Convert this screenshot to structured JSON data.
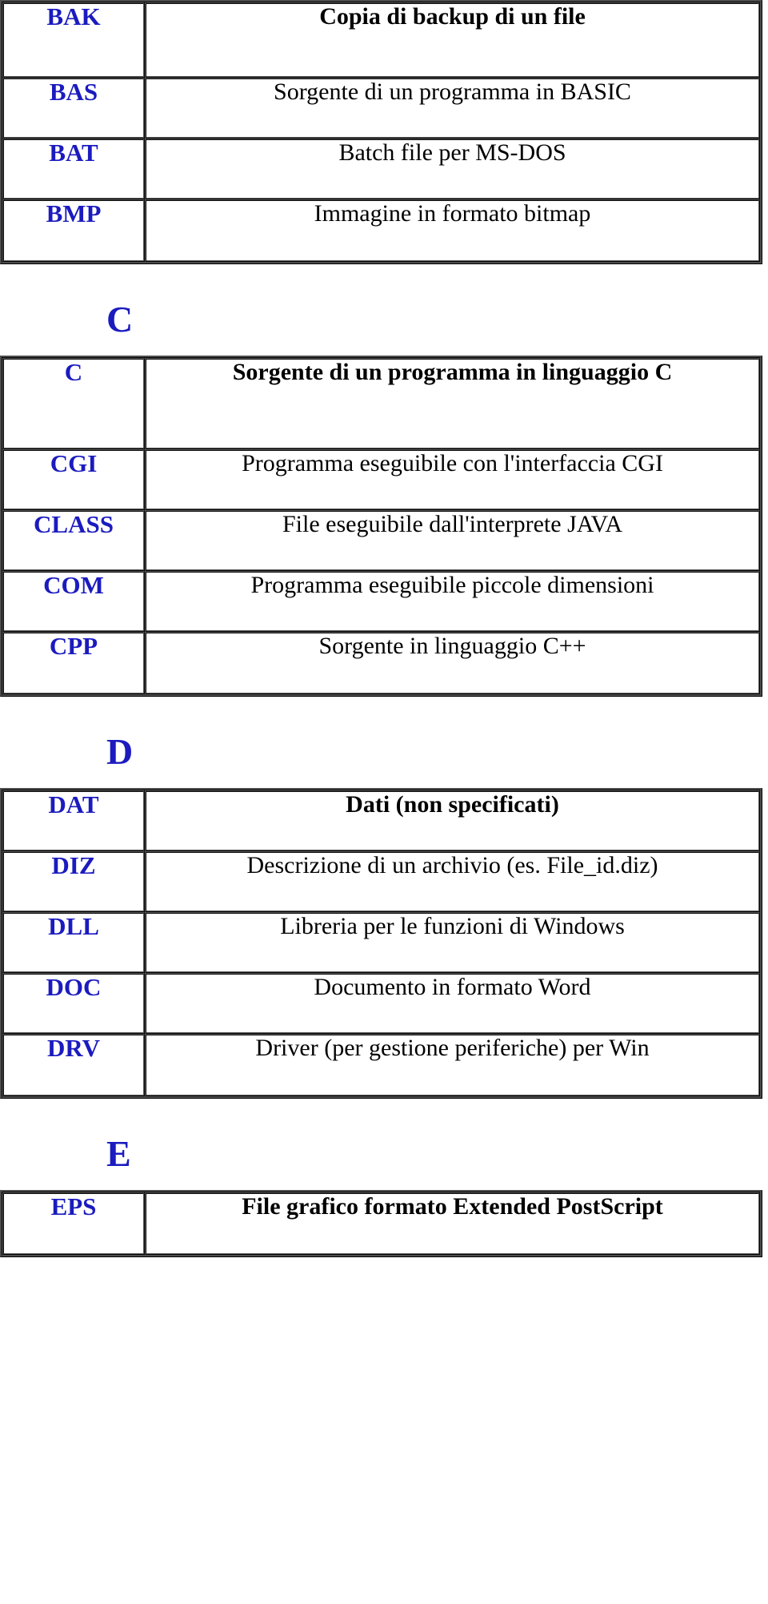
{
  "document": {
    "language": "it",
    "title_implied": "Estensioni dei file",
    "accent_color": "#1b1bbf",
    "text_color": "#000000",
    "background_color": "#ffffff"
  },
  "sections": [
    {
      "letter": "",
      "show_letter": false,
      "rows": [
        {
          "ext": "BAK",
          "desc": "Copia di backup di un file",
          "bold": true
        },
        {
          "ext": "BAS",
          "desc": "Sorgente di un programma in BASIC",
          "bold": false
        },
        {
          "ext": "BAT",
          "desc": "Batch file per MS-DOS",
          "bold": false
        },
        {
          "ext": "BMP",
          "desc": "Immagine in formato bitmap",
          "bold": false
        }
      ]
    },
    {
      "letter": "C",
      "show_letter": true,
      "rows": [
        {
          "ext": "C",
          "desc": "Sorgente di un programma in linguaggio C",
          "bold": true
        },
        {
          "ext": "CGI",
          "desc": "Programma eseguibile con l'interfaccia CGI",
          "bold": false
        },
        {
          "ext": "CLASS",
          "desc": "File eseguibile dall'interprete JAVA",
          "bold": false
        },
        {
          "ext": "COM",
          "desc": "Programma eseguibile piccole dimensioni",
          "bold": false
        },
        {
          "ext": "CPP",
          "desc": "Sorgente in linguaggio C++",
          "bold": false
        }
      ]
    },
    {
      "letter": "D",
      "show_letter": true,
      "rows": [
        {
          "ext": "DAT",
          "desc": "Dati (non specificati)",
          "bold": true
        },
        {
          "ext": "DIZ",
          "desc": "Descrizione di un archivio (es. File_id.diz)",
          "bold": false
        },
        {
          "ext": "DLL",
          "desc": "Libreria per le funzioni di Windows",
          "bold": false
        },
        {
          "ext": "DOC",
          "desc": "Documento in formato Word",
          "bold": false
        },
        {
          "ext": "DRV",
          "desc": "Driver (per gestione periferiche) per Win",
          "bold": false
        }
      ]
    },
    {
      "letter": "E",
      "show_letter": true,
      "rows": [
        {
          "ext": "EPS",
          "desc": "File grafico formato Extended PostScript",
          "bold": true
        }
      ]
    }
  ],
  "row_heights": {
    "table0": [
      100,
      82,
      82,
      84
    ],
    "table1": [
      120,
      82,
      82,
      82,
      84
    ],
    "table2": [
      82,
      82,
      82,
      82,
      84
    ],
    "table3": [
      84
    ]
  }
}
